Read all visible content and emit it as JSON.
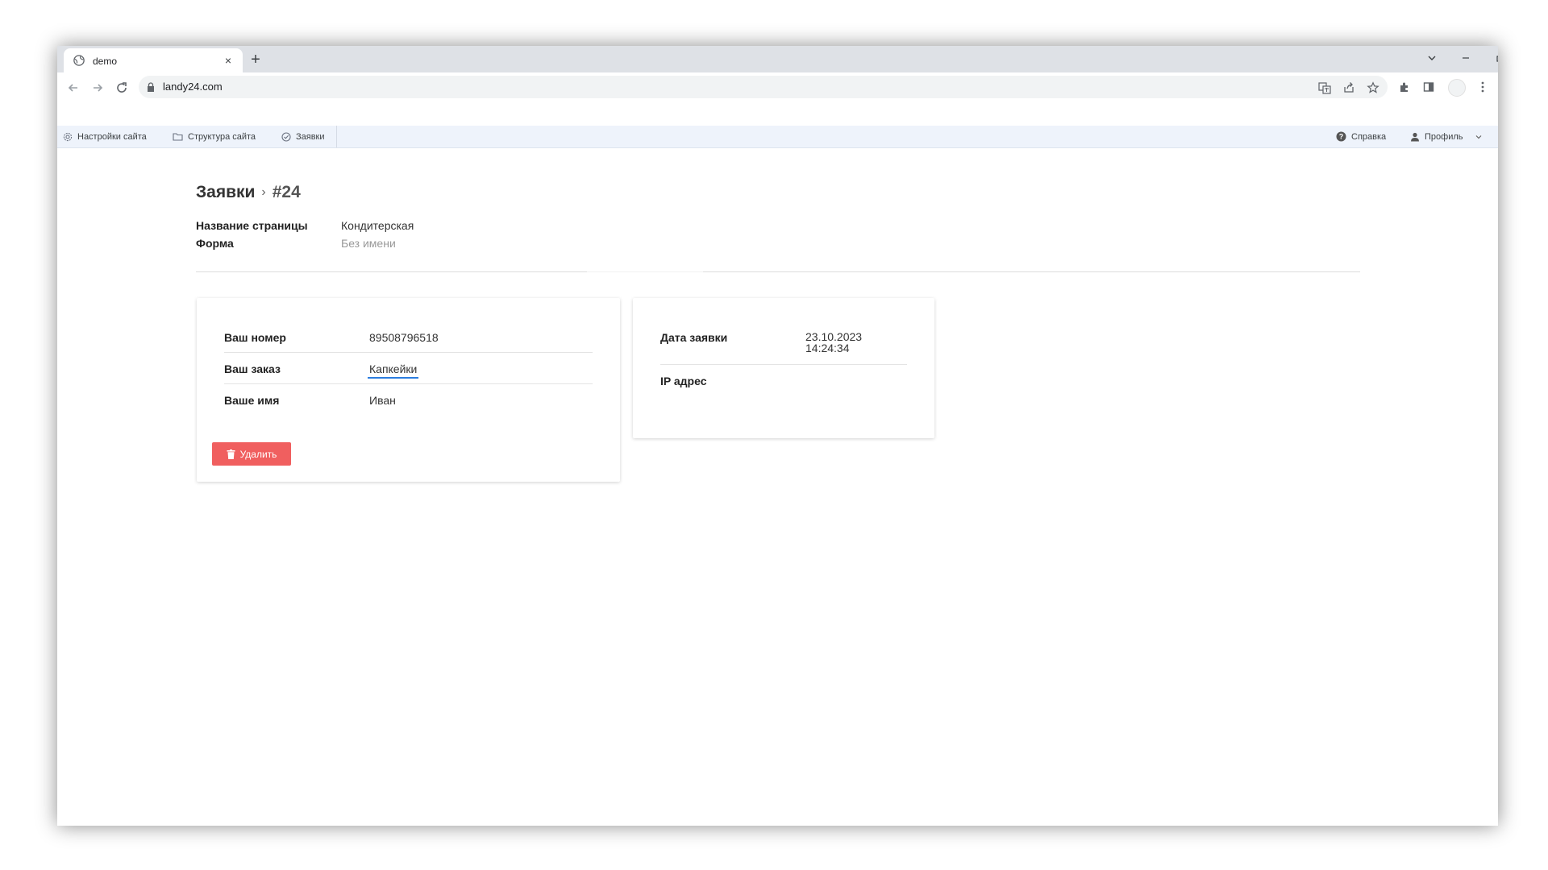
{
  "browser": {
    "tab_title": "demo",
    "tab_close": "×",
    "new_tab": "+",
    "url": "landy24.com"
  },
  "appnav": {
    "items": [
      {
        "label": "Настройки сайта",
        "icon": "gear-icon"
      },
      {
        "label": "Структура сайта",
        "icon": "folder-icon"
      },
      {
        "label": "Заявки",
        "icon": "check-circle-icon"
      }
    ],
    "help_label": "Справка",
    "profile_label": "Профиль"
  },
  "page": {
    "breadcrumb_root": "Заявки",
    "breadcrumb_current": "#24",
    "meta": [
      {
        "key": "Название страницы",
        "value": "Кондитерская"
      },
      {
        "key": "Форма",
        "value": "Без имени"
      }
    ]
  },
  "card_fields": [
    {
      "key": "Ваш номер",
      "value": "89508796518"
    },
    {
      "key": "Ваш заказ",
      "value": "Капкейки"
    },
    {
      "key": "Ваше имя",
      "value": "Иван"
    }
  ],
  "delete_button": "Удалить",
  "info": {
    "date_label": "Дата заявки",
    "date_value": "23.10.2023",
    "time_value": "14:24:34",
    "ip_label": "IP адрес",
    "ip_value": ""
  },
  "colors": {
    "accent": "#2b7de0",
    "danger": "#f05f5f",
    "nav_bg": "#eef3fb"
  }
}
